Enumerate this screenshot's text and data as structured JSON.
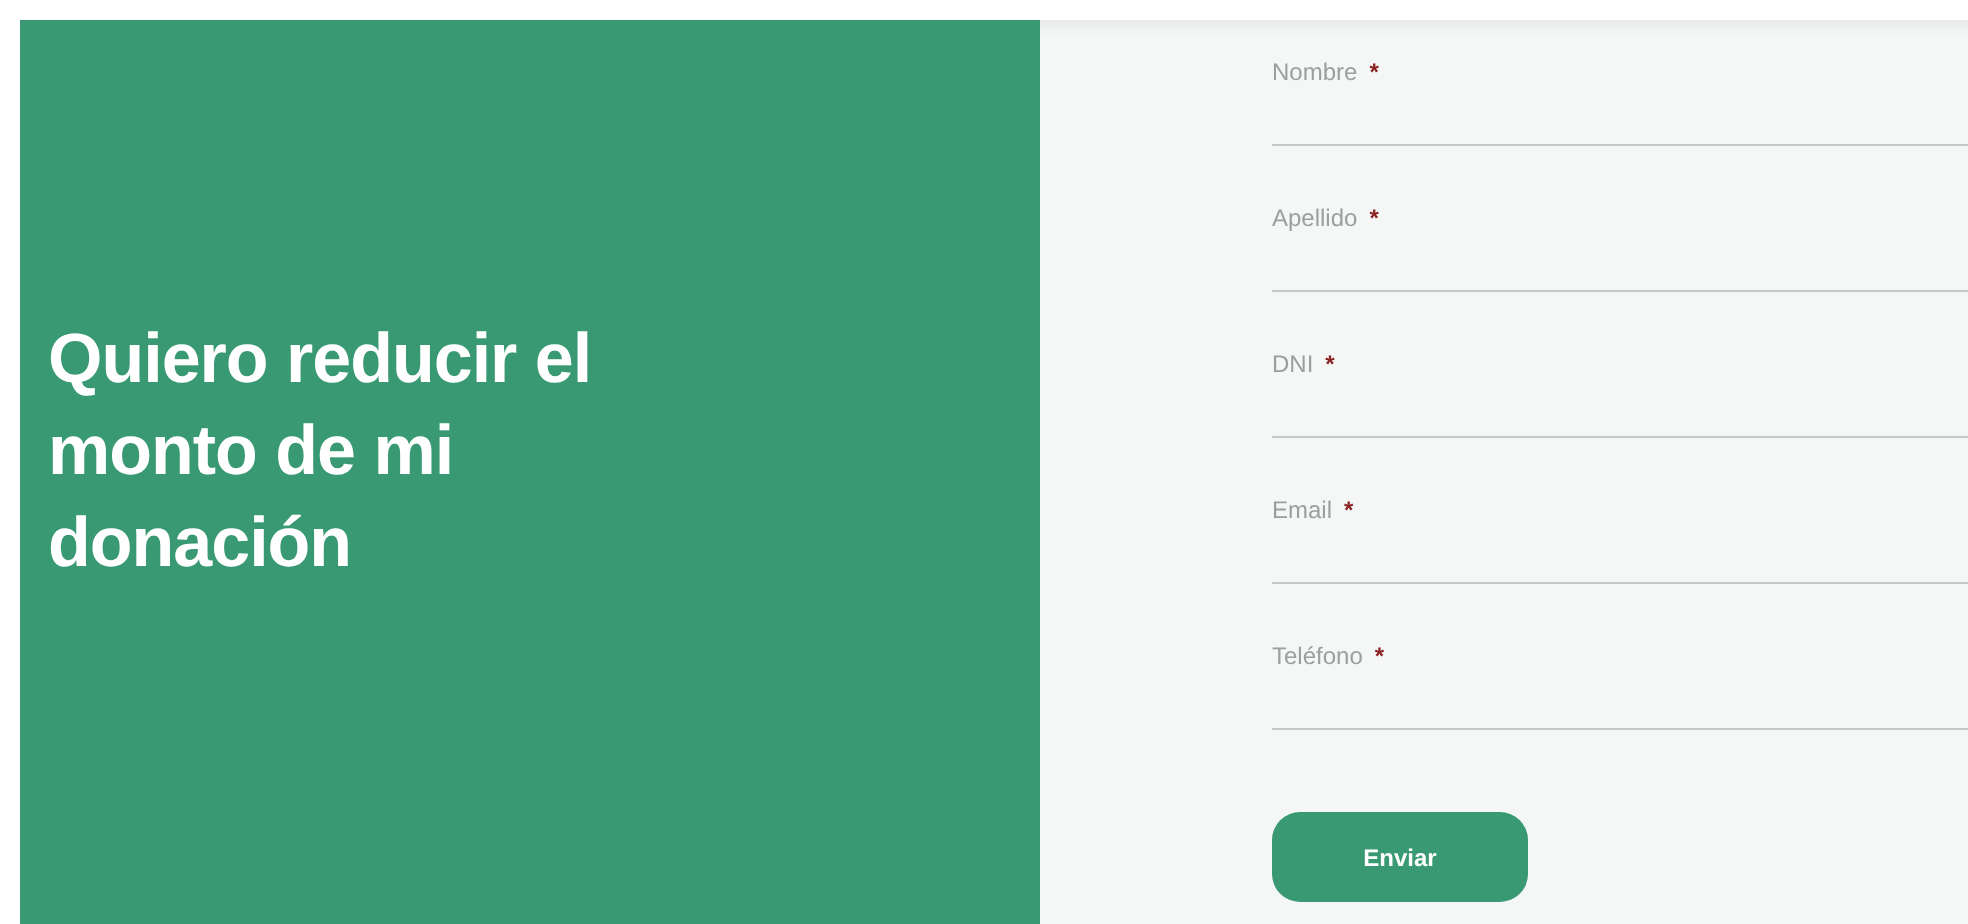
{
  "hero": {
    "title": "Quiero reducir el monto de mi donación"
  },
  "form": {
    "fields": [
      {
        "label": "Nombre",
        "required_mark": "*"
      },
      {
        "label": "Apellido",
        "required_mark": "*"
      },
      {
        "label": "DNI",
        "required_mark": "*"
      },
      {
        "label": "Email",
        "required_mark": "*"
      },
      {
        "label": "Teléfono",
        "required_mark": "*"
      }
    ],
    "submit": "Enviar"
  }
}
